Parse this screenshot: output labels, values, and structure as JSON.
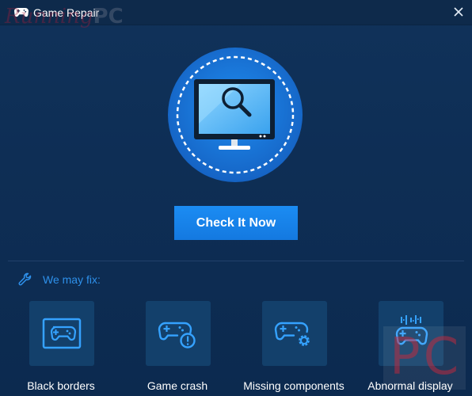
{
  "window": {
    "title": "Game Repair",
    "close_icon": "close-icon",
    "title_icon": "gamepad-icon"
  },
  "watermark": {
    "top_left_text": "Running",
    "top_left_pc": "PC",
    "bottom_right_text": "PC"
  },
  "hero": {
    "icon": "monitor-search-icon"
  },
  "check_button": {
    "label": "Check It Now"
  },
  "fix_section": {
    "label": "We may fix:",
    "icon": "wrench-icon",
    "items": [
      {
        "label": "Black borders",
        "icon": "gamepad-borders-icon"
      },
      {
        "label": "Game crash",
        "icon": "gamepad-crash-icon"
      },
      {
        "label": "Missing components",
        "icon": "gamepad-gear-icon"
      },
      {
        "label": "Abnormal display",
        "icon": "gamepad-display-icon"
      }
    ]
  },
  "colors": {
    "background": "#0e2e55",
    "accent": "#1b8cf3",
    "card": "#13406b",
    "label_blue": "#2e90ea"
  }
}
